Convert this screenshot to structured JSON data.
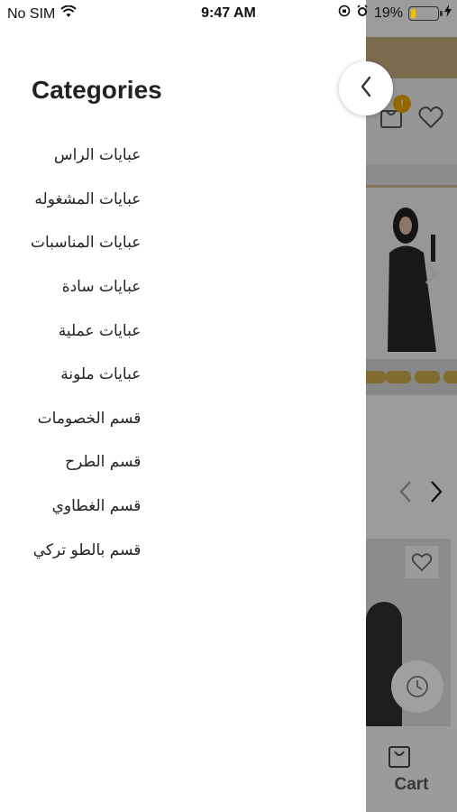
{
  "status_bar": {
    "carrier": "No SIM",
    "time": "9:47 AM",
    "battery_percent": "19%",
    "battery_level": 0.19,
    "battery_color": "#f2c200",
    "icons": [
      "wifi-icon",
      "orientation-lock-icon",
      "alarm-icon",
      "battery-icon",
      "charging-bolt-icon"
    ]
  },
  "drawer": {
    "title": "Categories",
    "categories": [
      "عبايات الراس",
      "عبايات المشغوله",
      "عبايات المناسبات",
      "عبايات سادة",
      "عبايات عملية",
      "عبايات ملونة",
      "قسم الخصومات",
      "قسم الطرح",
      "قسم الغطاوي",
      "قسم بالطو تركي"
    ],
    "close_icon": "chevron-left-icon"
  },
  "background": {
    "badge_count": "!",
    "tab_cart_label": "Cart",
    "icons": [
      "bag-icon",
      "heart-icon",
      "chevron-left-icon",
      "chevron-right-icon",
      "history-clock-icon",
      "cart-icon"
    ],
    "accent_color": "#bda77b"
  }
}
